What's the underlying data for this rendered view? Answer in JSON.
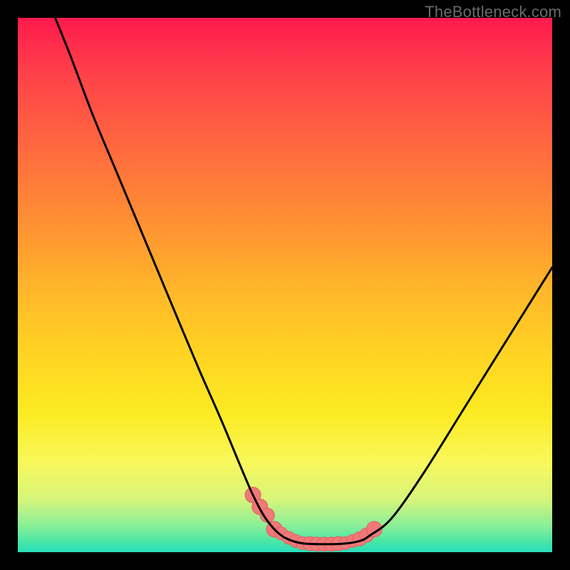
{
  "watermark": "TheBottleneck.com",
  "colors": {
    "curve": "#000000",
    "marker_fill": "#f07878",
    "marker_stroke": "#e06060",
    "gradient_top": "#ff1a4d",
    "gradient_bottom": "#29debb"
  },
  "chart_data": {
    "type": "line",
    "title": "",
    "xlabel": "",
    "ylabel": "",
    "xlim": [
      0,
      100
    ],
    "ylim": [
      0,
      100
    ],
    "note": "Values read approximately from curve pixel positions relative to 750x750 plot area; y is inverted (0 at bottom).",
    "series": [
      {
        "name": "curve",
        "x": [
          7,
          10,
          14,
          18,
          22,
          26,
          30,
          34,
          38,
          42,
          44,
          46,
          48,
          50,
          53,
          57,
          61,
          64,
          66,
          70,
          76,
          84,
          92,
          100
        ],
        "y": [
          100,
          92.5,
          81.9,
          72.3,
          62.7,
          53.1,
          43.5,
          34,
          24.9,
          15.3,
          10.7,
          6.9,
          4.3,
          2.7,
          1.7,
          1.5,
          1.6,
          2.1,
          3.2,
          6.4,
          14.9,
          27.7,
          40.5,
          53.3
        ]
      }
    ],
    "markers": {
      "name": "highlight-segment",
      "x": [
        44.0,
        45.3,
        46.7,
        48.0,
        49.3,
        50.7,
        52.0,
        53.3,
        54.7,
        56.0,
        57.3,
        58.7,
        60.0,
        61.3,
        62.7,
        64.0,
        65.3,
        66.7
      ],
      "y": [
        10.7,
        8.5,
        6.9,
        4.3,
        3.5,
        2.7,
        2.1,
        1.7,
        1.6,
        1.5,
        1.5,
        1.5,
        1.6,
        1.7,
        2.1,
        2.5,
        3.2,
        4.3
      ],
      "r": [
        11,
        11,
        10,
        11,
        9,
        9,
        9,
        9,
        10,
        10,
        10,
        10,
        10,
        9,
        9,
        10,
        10,
        11
      ]
    }
  }
}
